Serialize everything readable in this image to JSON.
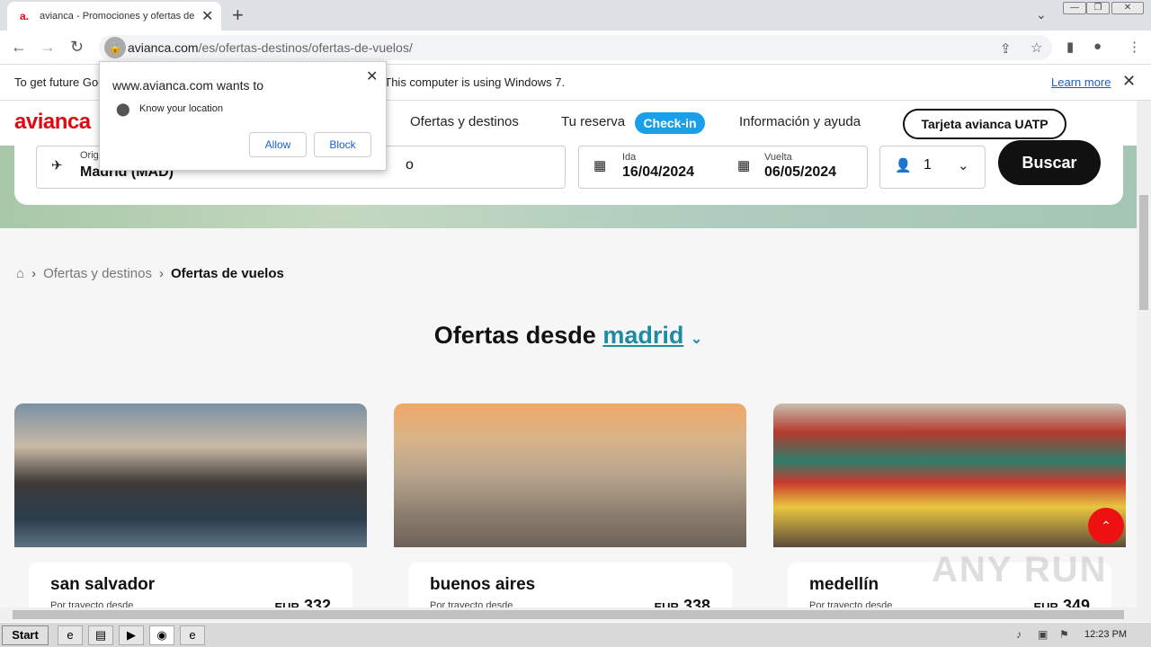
{
  "browser": {
    "tab_title": "avianca - Promociones y ofertas de v",
    "tab_favicon": "avianca-icon",
    "url_host": "avianca.com",
    "url_path": "/es/ofertas-destinos/ofertas-de-vuelos/"
  },
  "infobar": {
    "text": "To get future Google Chrome updates, you'll need Windows 10 or later. This computer is using Windows 7.",
    "learn_more": "Learn more"
  },
  "popup": {
    "title": "www.avianca.com wants to",
    "permission": "Know your location",
    "allow": "Allow",
    "block": "Block"
  },
  "header": {
    "logo": "avianca",
    "nav": [
      "Ofertas y destinos",
      "Tu reserva"
    ],
    "checkin": "Check-in",
    "nav_info": "Información y ayuda",
    "uatp": "Tarjeta avianca UATP"
  },
  "search": {
    "origin_label": "Origen",
    "origin_value": "Madrid (MAD)",
    "destination_value": "o",
    "ida_label": "Ida",
    "ida_value": "16/04/2024",
    "vuelta_label": "Vuelta",
    "vuelta_value": "06/05/2024",
    "passengers": "1",
    "buscar": "Buscar"
  },
  "breadcrumb": {
    "level1": "Ofertas y destinos",
    "current": "Ofertas de vuelos"
  },
  "offers": {
    "title_prefix": "Ofertas desde",
    "city": "madrid",
    "cards": [
      {
        "city": "san salvador",
        "sub": "Por trayecto desde",
        "currency": "EUR",
        "price": "332"
      },
      {
        "city": "buenos aires",
        "sub": "Por trayecto desde",
        "currency": "EUR",
        "price": "338"
      },
      {
        "city": "medellín",
        "sub": "Por trayecto desde",
        "currency": "EUR",
        "price": "349"
      }
    ]
  },
  "taskbar": {
    "start": "Start",
    "clock": "12:23 PM"
  },
  "watermark": "ANY RUN"
}
